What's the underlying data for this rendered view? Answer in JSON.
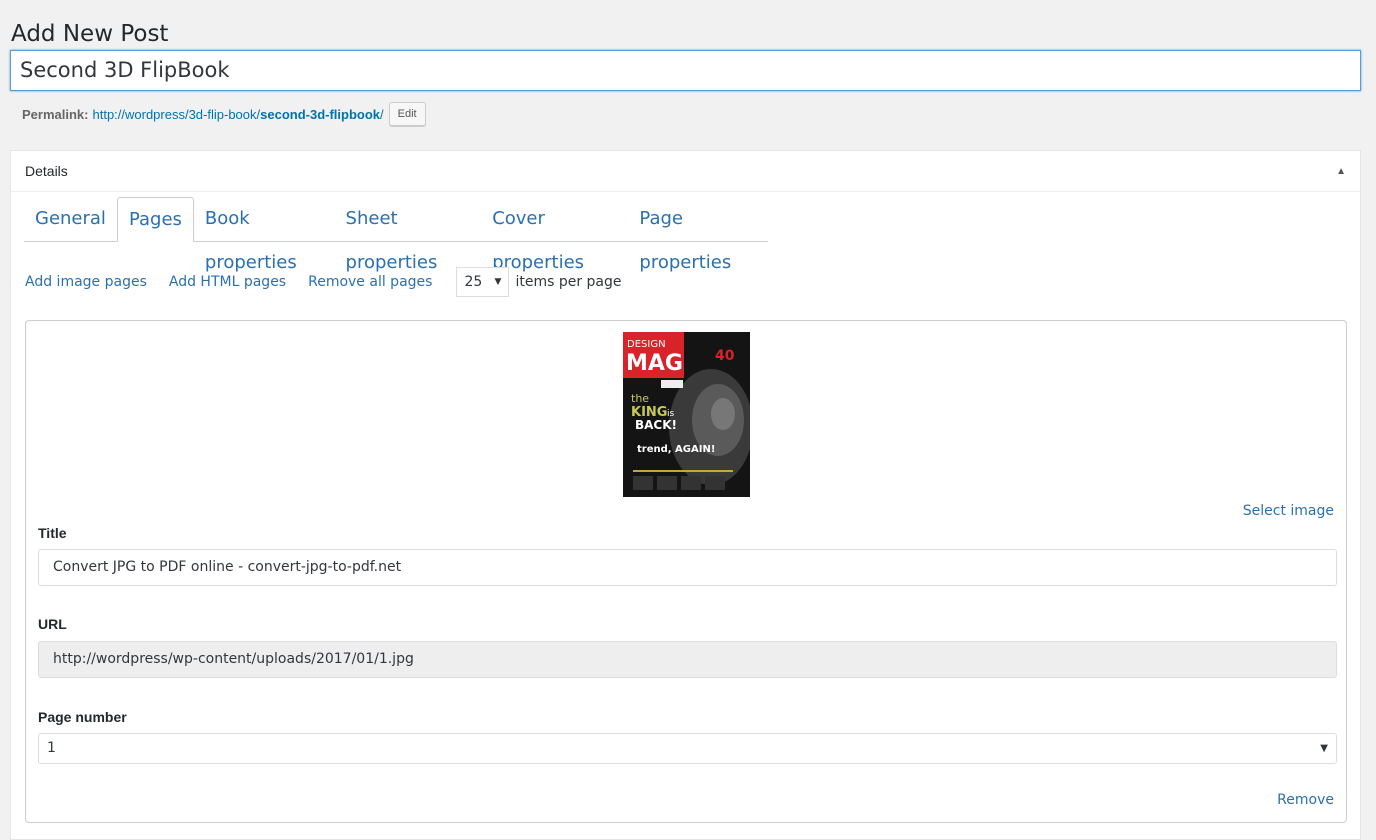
{
  "page_title": "Add New Post",
  "post_title": "Second 3D FlipBook",
  "permalink": {
    "label": "Permalink:",
    "base": "http://wordpress/3d-flip-book/",
    "slug": "second-3d-flipbook",
    "trail": "/",
    "edit_label": "Edit"
  },
  "details": {
    "header": "Details",
    "toggle_icon": "triangle-up-icon"
  },
  "tabs": [
    {
      "label": "General"
    },
    {
      "label": "Pages"
    },
    {
      "label": "Book properties"
    },
    {
      "label": "Sheet properties"
    },
    {
      "label": "Cover properties"
    },
    {
      "label": "Page properties"
    }
  ],
  "active_tab": "Pages",
  "toolbar": {
    "add_image_pages": "Add image pages",
    "add_html_pages": "Add HTML pages",
    "remove_all_pages": "Remove all pages",
    "per_page_value": "25",
    "per_page_label": "items per page"
  },
  "page_item": {
    "thumbnail": {
      "brand_top": "DESIGN",
      "brand": "MAG",
      "issue_num": "40",
      "line1": "the",
      "line2": "KING",
      "line2b": "is",
      "line3": "BACK!",
      "line4": "trend, AGAIN!"
    },
    "select_image_label": "Select image",
    "title_label": "Title",
    "title_value": "Convert JPG to PDF online - convert-jpg-to-pdf.net",
    "url_label": "URL",
    "url_value": "http://wordpress/wp-content/uploads/2017/01/1.jpg",
    "page_number_label": "Page number",
    "page_number_value": "1",
    "remove_label": "Remove"
  },
  "colors": {
    "link": "#2a70b0",
    "focus_border": "#5b9dd9",
    "magazine_red": "#d8232a"
  }
}
